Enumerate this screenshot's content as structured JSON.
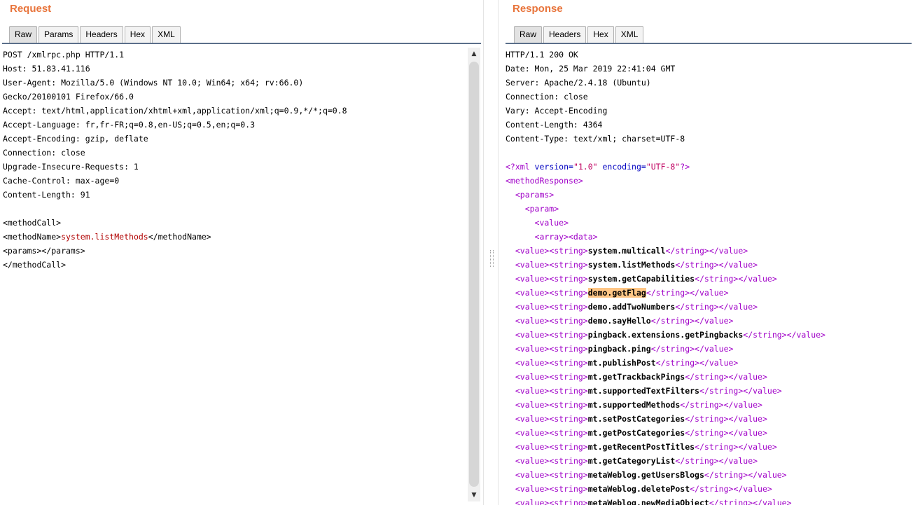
{
  "request": {
    "title": "Request",
    "tabs": [
      "Raw",
      "Params",
      "Headers",
      "Hex",
      "XML"
    ],
    "lines": [
      "POST /xmlrpc.php HTTP/1.1",
      "Host: 51.83.41.116",
      "User-Agent: Mozilla/5.0 (Windows NT 10.0; Win64; x64; rv:66.0)",
      "Gecko/20100101 Firefox/66.0",
      "Accept: text/html,application/xhtml+xml,application/xml;q=0.9,*/*;q=0.8",
      "Accept-Language: fr,fr-FR;q=0.8,en-US;q=0.5,en;q=0.3",
      "Accept-Encoding: gzip, deflate",
      "Connection: close",
      "Upgrade-Insecure-Requests: 1",
      "Cache-Control: max-age=0",
      "Content-Length: 91",
      "",
      "<methodCall>"
    ],
    "method_line": {
      "open": "<methodName>",
      "value": "system.listMethods",
      "close": "</methodName>"
    },
    "tail_lines": [
      "<params></params>",
      "</methodCall>"
    ],
    "scroll_up": "▲",
    "scroll_down": "▼"
  },
  "response": {
    "title": "Response",
    "tabs": [
      "Raw",
      "Headers",
      "Hex",
      "XML"
    ],
    "headers": [
      "HTTP/1.1 200 OK",
      "Date: Mon, 25 Mar 2019 22:41:04 GMT",
      "Server: Apache/2.4.18 (Ubuntu)",
      "Connection: close",
      "Vary: Accept-Encoding",
      "Content-Length: 4364",
      "Content-Type: text/xml; charset=UTF-8",
      ""
    ],
    "xml_decl": {
      "open": "<?xml ",
      "attr1": "version=",
      "val1": "\"1.0\"",
      "attr2": " encoding=",
      "val2": "\"UTF-8\"",
      "close": "?>"
    },
    "structure": [
      "<methodResponse>",
      "  <params>",
      "    <param>",
      "      <value>",
      "      <array><data>"
    ],
    "methods": [
      "system.multicall",
      "system.listMethods",
      "system.getCapabilities",
      "demo.getFlag",
      "demo.addTwoNumbers",
      "demo.sayHello",
      "pingback.extensions.getPingbacks",
      "pingback.ping",
      "mt.publishPost",
      "mt.getTrackbackPings",
      "mt.supportedTextFilters",
      "mt.supportedMethods",
      "mt.setPostCategories",
      "mt.getPostCategories",
      "mt.getRecentPostTitles",
      "mt.getCategoryList",
      "metaWeblog.getUsersBlogs",
      "metaWeblog.deletePost",
      "metaWeblog.newMediaObject"
    ],
    "highlighted_method": "demo.getFlag",
    "value_open": "<value>",
    "string_open": "<string>",
    "string_close": "</string>",
    "value_close": "</value>"
  },
  "colors": {
    "title": "#e8743b",
    "tag": "#a000c8",
    "attr": "#0000c0",
    "attr_value": "#c00060",
    "method_value": "#b00000",
    "highlight": "#ffc685"
  }
}
